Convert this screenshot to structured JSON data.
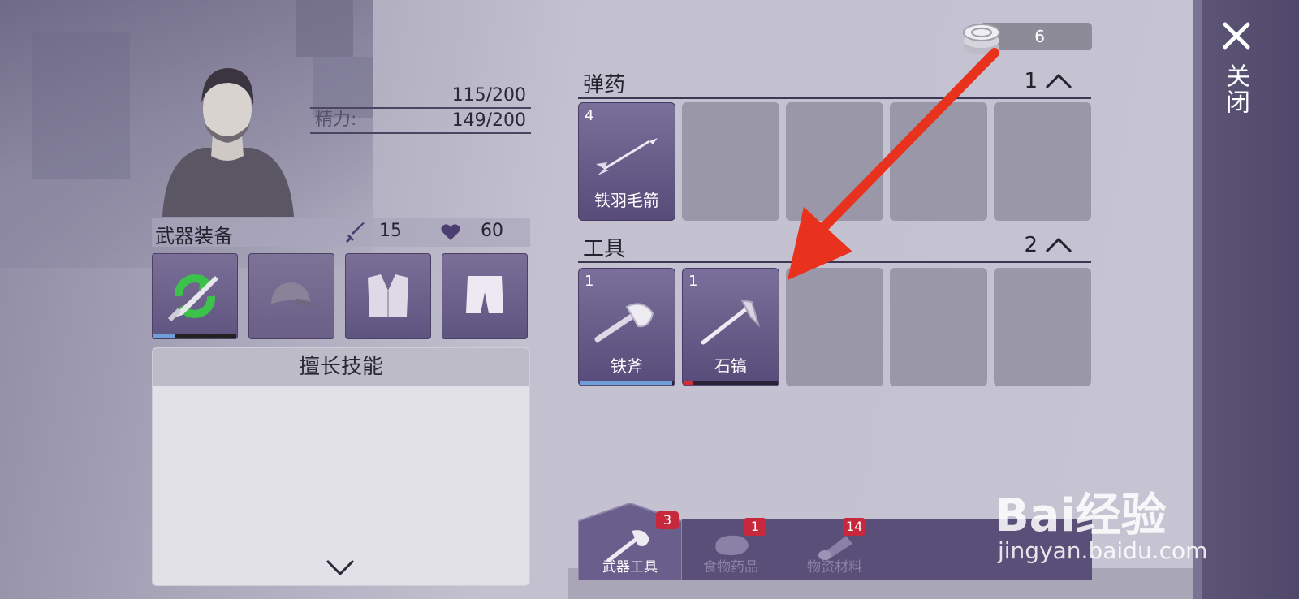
{
  "close": {
    "label": "关闭",
    "icon": "close-icon"
  },
  "stats": [
    {
      "label": "",
      "value": "115/200"
    },
    {
      "label": "精力:",
      "value": "149/200"
    }
  ],
  "equipment": {
    "title": "武器装备",
    "attack": "15",
    "health": "60",
    "slots": [
      {
        "icon": "machete-icon",
        "durability": 0.25
      },
      {
        "icon": "cap-icon"
      },
      {
        "icon": "vest-icon"
      },
      {
        "icon": "shorts-icon"
      }
    ]
  },
  "skills": {
    "title": "擅长技能"
  },
  "coins": "6",
  "ammo": {
    "title": "弹药",
    "count": "1",
    "items": [
      {
        "name": "铁羽毛箭",
        "count": "4",
        "icon": "arrow-icon"
      }
    ]
  },
  "tools": {
    "title": "工具",
    "count": "2",
    "items": [
      {
        "name": "铁斧",
        "count": "1",
        "icon": "axe-icon",
        "durability": 0.98,
        "color": "#6f9ed9"
      },
      {
        "name": "石镐",
        "count": "1",
        "icon": "pickaxe-icon",
        "durability": 0.1,
        "color": "#d03030"
      }
    ]
  },
  "tabs": [
    {
      "label": "武器工具",
      "badge": "3",
      "icon": "weapon-tool-icon"
    },
    {
      "label": "食物药品",
      "badge": "1",
      "icon": "meat-icon"
    },
    {
      "label": "物资材料",
      "badge": "14",
      "icon": "log-icon"
    }
  ],
  "watermark": {
    "big": "Bai经验",
    "small": "jingyan.baidu.com"
  },
  "colors": {
    "accent_red": "#e8321e",
    "slot_purple": "#6a5f8c",
    "badge_red": "#c8283c"
  }
}
